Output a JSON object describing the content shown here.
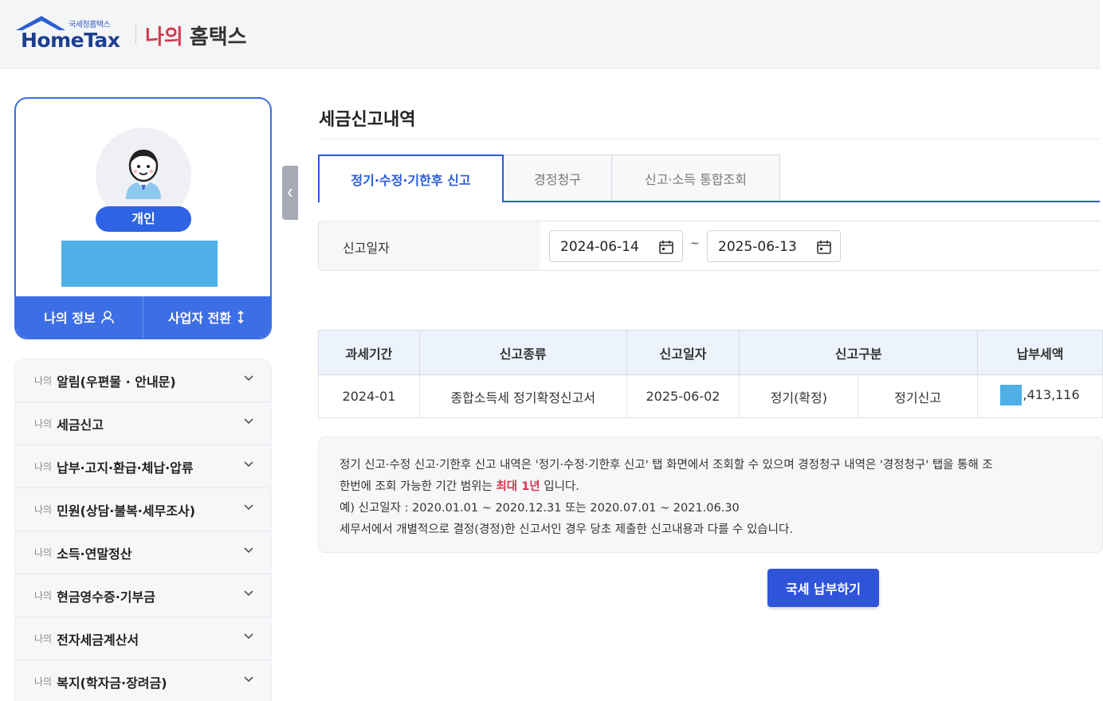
{
  "header": {
    "logo_small": "국세청홈택스",
    "logo_text": "HomeTax",
    "my_label": "나의",
    "hometax_label": "홈택스"
  },
  "profile": {
    "badge": "개인",
    "my_info": "나의 정보",
    "switch_business": "사업자 전환"
  },
  "side_menu": {
    "prefix": "나의",
    "items": [
      {
        "label": "알림(우편물 · 안내문)"
      },
      {
        "label": "세금신고"
      },
      {
        "label": "납부·고지·환급·체납·압류"
      },
      {
        "label": "민원(상담·불복·세무조사)"
      },
      {
        "label": "소득·연말정산"
      },
      {
        "label": "현금영수증·기부금"
      },
      {
        "label": "전자세금계산서"
      },
      {
        "label": "복지(학자금·장려금)"
      }
    ]
  },
  "main": {
    "title": "세금신고내역",
    "tabs": [
      {
        "label": "정기·수정·기한후 신고"
      },
      {
        "label": "경정청구"
      },
      {
        "label": "신고·소득 통합조회"
      }
    ],
    "filter": {
      "label": "신고일자",
      "start_date": "2024-06-14",
      "separator": "~",
      "end_date": "2025-06-13"
    },
    "table": {
      "headers": [
        "과세기간",
        "신고종류",
        "신고일자",
        "신고구분",
        "납부세액"
      ],
      "rows": [
        {
          "period": "2024-01",
          "type": "종합소득세 정기확정신고서",
          "date": "2025-06-02",
          "category1": "정기(확정)",
          "category2": "정기신고",
          "amount": ",413,116"
        }
      ]
    },
    "notice": {
      "line1": "정기 신고·수정 신고·기한후 신고 내역은 '정기·수정·기한후 신고' 탭 화면에서 조회할 수 있으며 경정청구 내역은 '경정청구' 탭을 통해 조",
      "line2_pre": "한번에 조회 가능한 기간 범위는",
      "line2_hl": "최대 1년",
      "line2_post": "입니다.",
      "line3": "예) 신고일자 : 2020.01.01 ~ 2020.12.31 또는 2020.07.01 ~ 2021.06.30",
      "line4": "세무서에서 개별적으로 결정(경정)한 신고서인 경우 당초 제출한 신고내용과 다를 수 있습니다."
    },
    "pay_button": "국세 납부하기"
  },
  "colors": {
    "primary": "#3c6ee6",
    "tab_active": "#2a5bd7",
    "brand_red": "#d4384e",
    "redaction": "#4fb0e8",
    "button": "#2f54d9"
  }
}
